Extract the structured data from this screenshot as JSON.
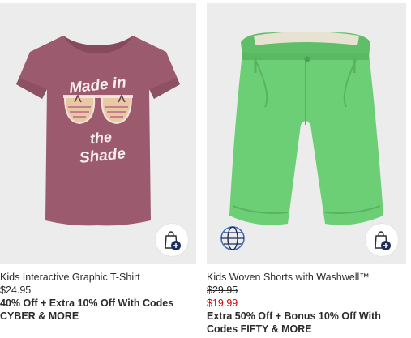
{
  "products": [
    {
      "title": "Kids Interactive Graphic T-Shirt",
      "price": "$24.95",
      "promo": "40% Off + Extra 10% Off With Codes CYBER & MORE",
      "graphic_text_line1": "Made in",
      "graphic_text_line2": "the",
      "graphic_text_line3": "Shade",
      "shirt_color": "#9b5a6e"
    },
    {
      "title": "Kids Woven Shorts with Washwell™",
      "original_price": "$29.95",
      "sale_price": "$19.99",
      "promo": "Extra 50% Off + Bonus 10% Off With Codes FIFTY & MORE",
      "shorts_color": "#6ccf76"
    }
  ],
  "icons": {
    "add_to_bag": "shopping-bag-plus-icon",
    "sustainability": "globe-icon"
  },
  "colors": {
    "sale_red": "#d00000",
    "navy": "#1f2d5a",
    "image_bg": "#ececec"
  }
}
